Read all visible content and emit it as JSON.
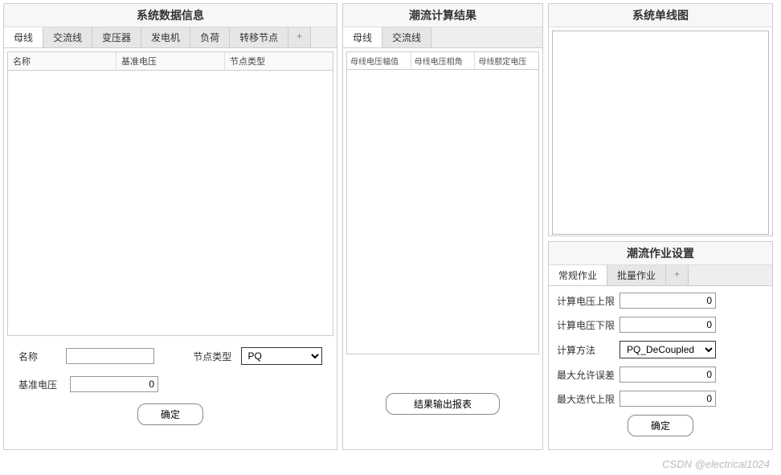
{
  "left": {
    "title": "系统数据信息",
    "tabs": [
      "母线",
      "交流线",
      "变压器",
      "发电机",
      "负荷",
      "转移节点"
    ],
    "add_tab": "+",
    "table_headers": [
      "名称",
      "基准电压",
      "节点类型"
    ],
    "form": {
      "name_label": "名称",
      "name_value": "",
      "node_type_label": "节点类型",
      "node_type_value": "PQ",
      "base_v_label": "基准电压",
      "base_v_value": "0",
      "submit": "确定"
    }
  },
  "middle_top": {
    "title": "系统单线图"
  },
  "middle_bottom": {
    "title": "潮流作业设置",
    "tabs": [
      "常规作业",
      "批量作业"
    ],
    "add_tab": "+",
    "fields": {
      "v_upper_label": "计算电压上限",
      "v_upper_value": "0",
      "v_lower_label": "计算电压下限",
      "v_lower_value": "0",
      "method_label": "计算方法",
      "method_value": "PQ_DeCoupled",
      "tol_label": "最大允许误差",
      "tol_value": "0",
      "iter_label": "最大迭代上限",
      "iter_value": "0",
      "submit": "确定"
    }
  },
  "right": {
    "title": "潮流计算结果",
    "tabs": [
      "母线",
      "交流线"
    ],
    "table_headers": [
      "母线电压幅值",
      "母线电压相角",
      "母线额定电压"
    ],
    "export_button": "结果输出报表"
  },
  "watermark": "CSDN @electrical1024"
}
